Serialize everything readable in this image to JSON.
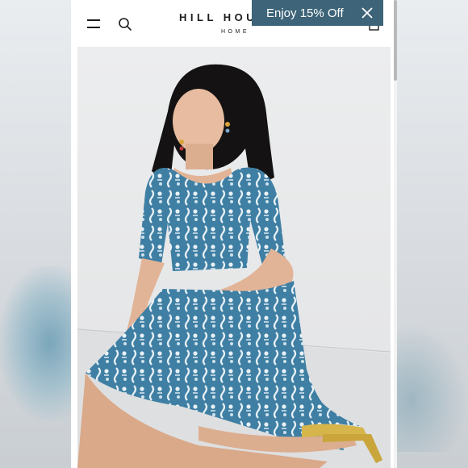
{
  "header": {
    "logo_main": "HILL HOUSE",
    "logo_sub": "HOME"
  },
  "promo": {
    "text": "Enjoy 15% Off",
    "background": "#3d6478"
  },
  "product": {
    "image_alt": "model wearing blue floral smocked puff-sleeve midi dress",
    "dress_color": "#3f7fa4"
  },
  "icons": [
    "menu-icon",
    "search-icon",
    "logo",
    "bag-icon",
    "close-icon"
  ]
}
